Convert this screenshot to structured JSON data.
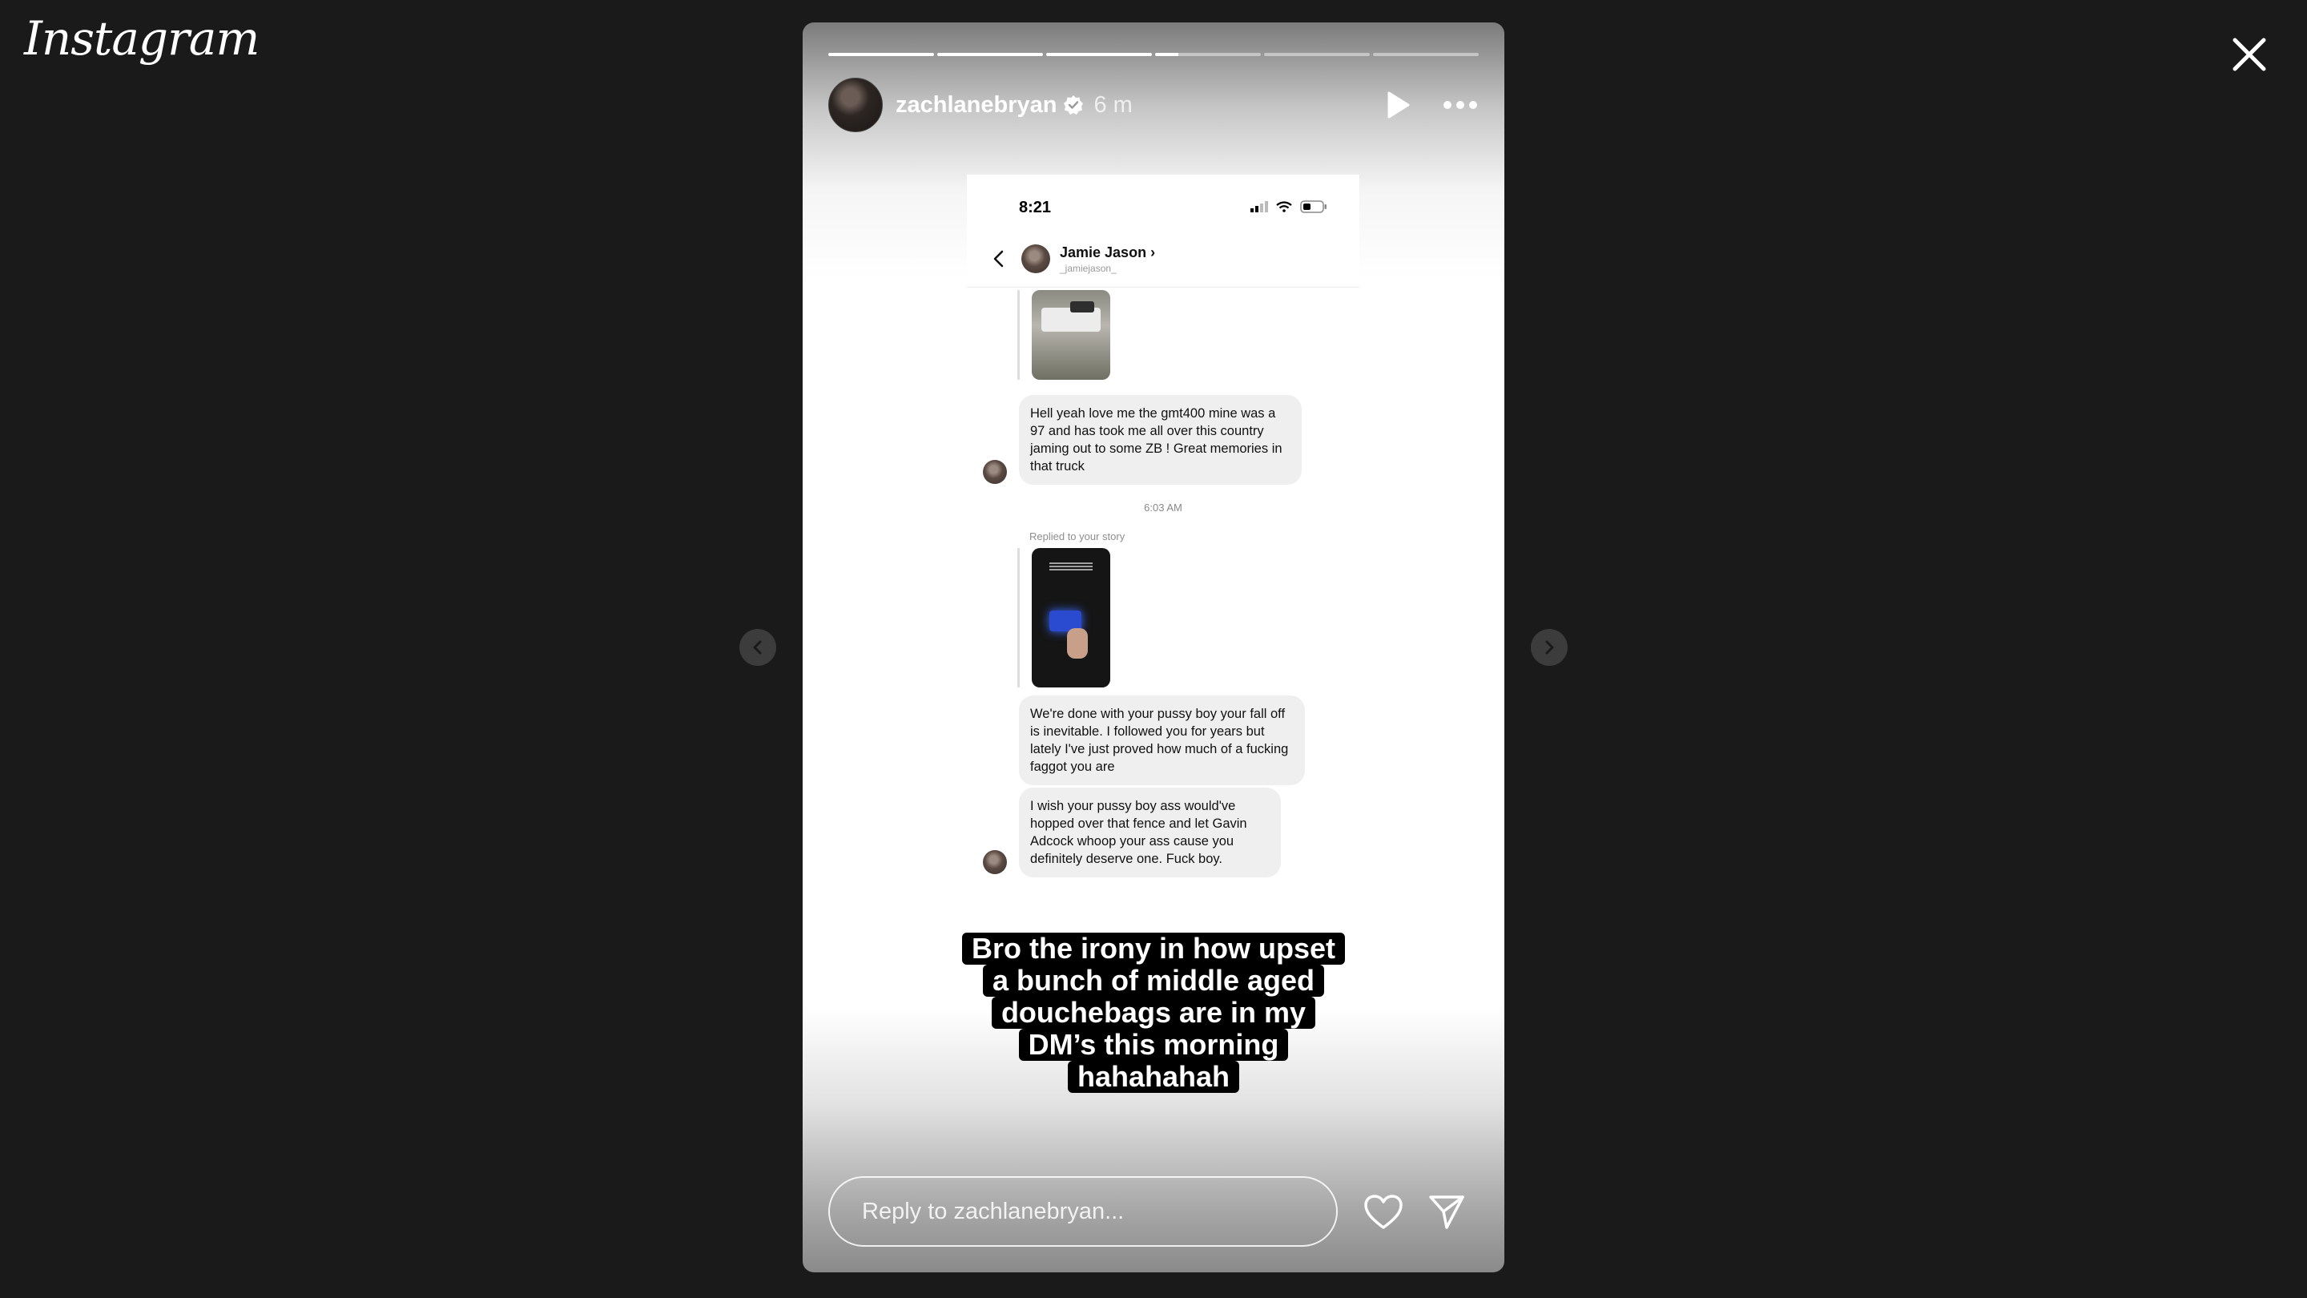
{
  "app": {
    "logo": "Instagram"
  },
  "story": {
    "username": "zachlanebryan",
    "time_ago": "6 m",
    "progress": [
      1,
      1,
      1,
      0.22,
      0,
      0
    ],
    "caption_lines": [
      "Bro the irony in how upset",
      "a bunch of middle aged",
      "douchebags are in my",
      "DM’s this morning",
      "hahahahah"
    ]
  },
  "screenshot": {
    "status_time": "8:21",
    "contact_name": "Jamie Jason",
    "contact_handle": "_jamiejason_",
    "message1": "Hell yeah love me the gmt400 mine was a 97 and has took me all over this country jaming out to some ZB ! Great memories in that truck",
    "timestamp": "6:03 AM",
    "replied_label": "Replied to your story",
    "message2": "We're done with your pussy boy your fall off is inevitable. I followed you for years but lately I've just proved how much of a fucking faggot you are",
    "message3": "I wish your pussy boy ass would've hopped over that fence and let Gavin Adcock whoop your ass cause you definitely deserve one. Fuck boy."
  },
  "reply": {
    "placeholder": "Reply to zachlanebryan..."
  },
  "icons": {
    "close": "close-icon",
    "prev": "chevron-left-icon",
    "next": "chevron-right-icon",
    "play": "play-icon",
    "more": "more-horizontal-icon",
    "verified": "verified-badge-icon",
    "heart": "heart-icon",
    "send": "send-icon"
  },
  "colors": {
    "background": "#1a1a1a",
    "verified": "#ffffff",
    "bubble": "#efefef"
  }
}
